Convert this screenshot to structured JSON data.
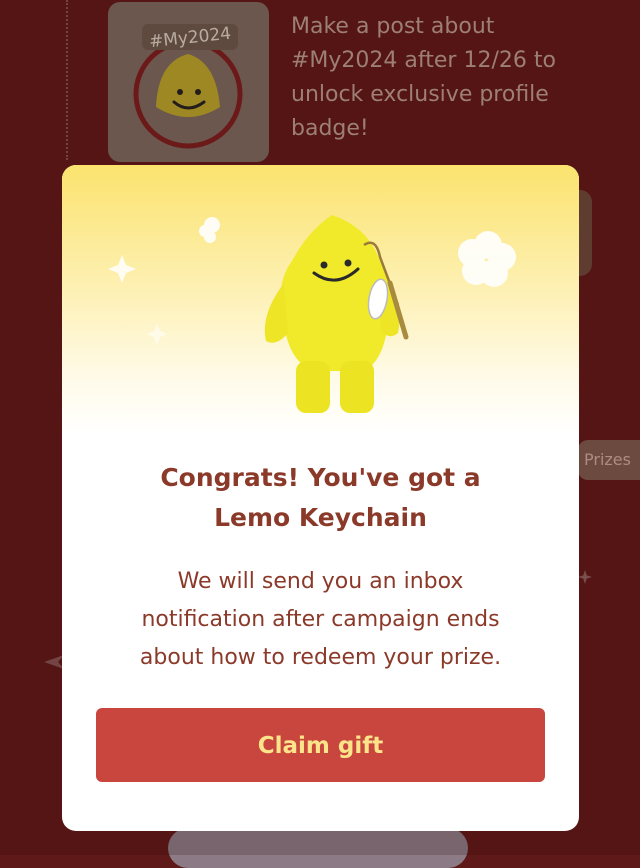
{
  "background": {
    "post_prompt_lines": [
      "Make a post about",
      "#My2024 after 12/26 to",
      "unlock exclusive profile",
      "badge!"
    ],
    "badge_lettering": "#My2024",
    "prizes_tab_label": "Prizes"
  },
  "modal": {
    "title_lines": [
      "Congrats! You've got a",
      "Lemo Keychain"
    ],
    "message_lines": [
      "We will send you an inbox",
      "notification after campaign ends",
      "about how to redeem your prize."
    ],
    "claim_button_label": "Claim gift"
  },
  "colors": {
    "page_background": "#5e1918",
    "title_text": "#8b3a2a",
    "button_background": "#c8463d",
    "button_text": "#fbe48a",
    "hero_gradient_top": "#fbe36e"
  },
  "icons": [
    "my2024-badge-icon",
    "lemo-keychain-image",
    "sparkle-icon",
    "flower-icon"
  ]
}
